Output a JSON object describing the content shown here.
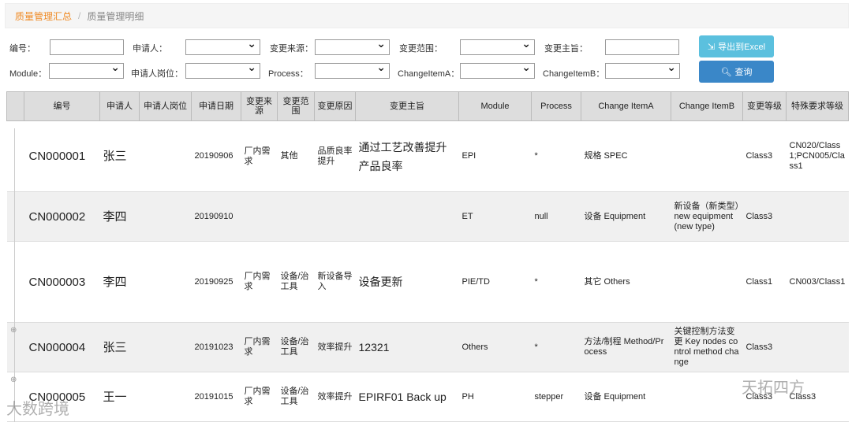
{
  "breadcrumb": {
    "active": "质量管理汇总",
    "separator": "/",
    "current": "质量管理明细"
  },
  "filters": {
    "id": "编号：",
    "applicant": "申请人：",
    "source": "变更来源：",
    "scope": "变更范围：",
    "subject": "变更主旨：",
    "module": "Module：",
    "position": "申请人岗位：",
    "process": "Process：",
    "itemA": "ChangeItemA：",
    "itemB": "ChangeItemB："
  },
  "buttons": {
    "export": "导出到Excel",
    "query": "查询"
  },
  "columns": [
    "",
    "编号",
    "申请人",
    "申请人岗位",
    "申请日期",
    "变更来源",
    "变更范围",
    "变更原因",
    "变更主旨",
    "Module",
    "Process",
    "Change ItemA",
    "Change ItemB",
    "变更等级",
    "特殊要求等级"
  ],
  "rows": [
    [
      "CN000001",
      "张三",
      "",
      "20190906",
      "厂内需求",
      "其他",
      "品质良率提升",
      "通过工艺改善提升产品良率",
      "EPI",
      "*",
      "规格 SPEC",
      "",
      "Class3",
      "CN020/Class1;PCN005/Class1"
    ],
    [
      "CN000002",
      "李四",
      "",
      "20190910",
      "",
      "",
      "",
      "",
      "ET",
      "null",
      "设备 Equipment",
      "新设备（新类型）new equipment(new type)",
      "Class3",
      ""
    ],
    [
      "CN000003",
      "李四",
      "",
      "20190925",
      "厂内需求",
      "设备/治工具",
      "新设备导入",
      "设备更新",
      "PIE/TD",
      "*",
      "其它 Others",
      "",
      "Class1",
      "CN003/Class1"
    ],
    [
      "CN000004",
      "张三",
      "",
      "20191023",
      "厂内需求",
      "设备/治工具",
      "效率提升",
      "12321",
      "Others",
      "*",
      "方法/制程 Method/Process",
      "关键控制方法变更 Key nodes control method change",
      "Class3",
      ""
    ],
    [
      "CN000005",
      "王一",
      "",
      "20191015",
      "厂内需求",
      "设备/治工具",
      "效率提升",
      "EPIRF01 Back up",
      "PH",
      "stepper",
      "设备 Equipment",
      "",
      "Class3",
      "Class3"
    ]
  ],
  "watermarks": [
    "大数跨境",
    "天拓四方"
  ]
}
